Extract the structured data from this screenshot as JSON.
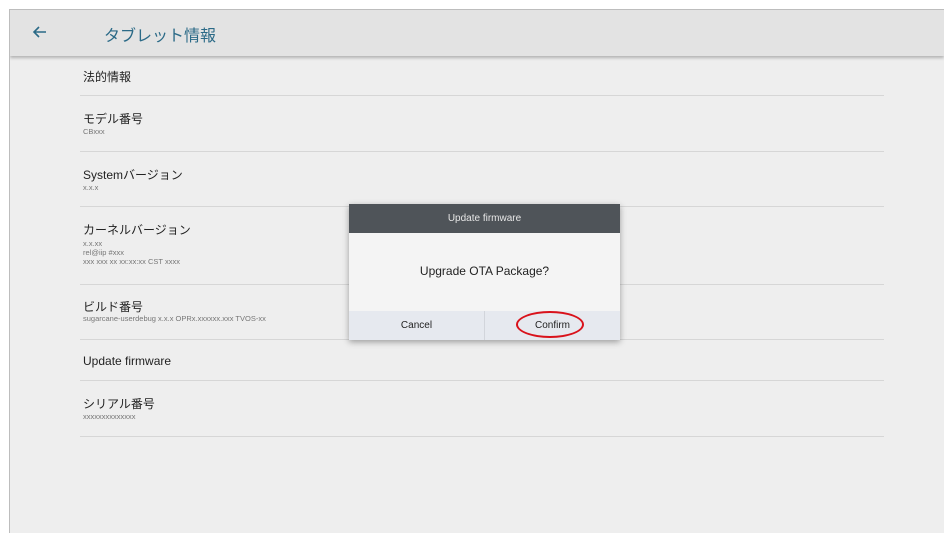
{
  "appbar": {
    "back_icon": "arrow-back-icon",
    "title": "タブレット情報"
  },
  "rows": [
    {
      "title": "法的情報",
      "sub": []
    },
    {
      "title": "モデル番号",
      "sub": [
        "CBxxx"
      ]
    },
    {
      "title": "Systemバージョン",
      "sub": [
        "x.x.x"
      ]
    },
    {
      "title": "カーネルバージョン",
      "sub": [
        "x.x.xx",
        "rel@iip #xxx",
        "xxx xxx xx xx:xx:xx CST xxxx"
      ]
    },
    {
      "title": "ビルド番号",
      "sub": [
        "sugarcane-userdebug x.x.x OPRx.xxxxxx.xxx TVOS-xx"
      ]
    },
    {
      "title": "Update firmware",
      "sub": []
    },
    {
      "title": "シリアル番号",
      "sub": [
        "xxxxxxxxxxxxxx"
      ]
    }
  ],
  "dialog": {
    "title": "Update firmware",
    "message": "Upgrade OTA Package?",
    "cancel": "Cancel",
    "confirm": "Confirm"
  },
  "highlight_color": "#d9121b"
}
